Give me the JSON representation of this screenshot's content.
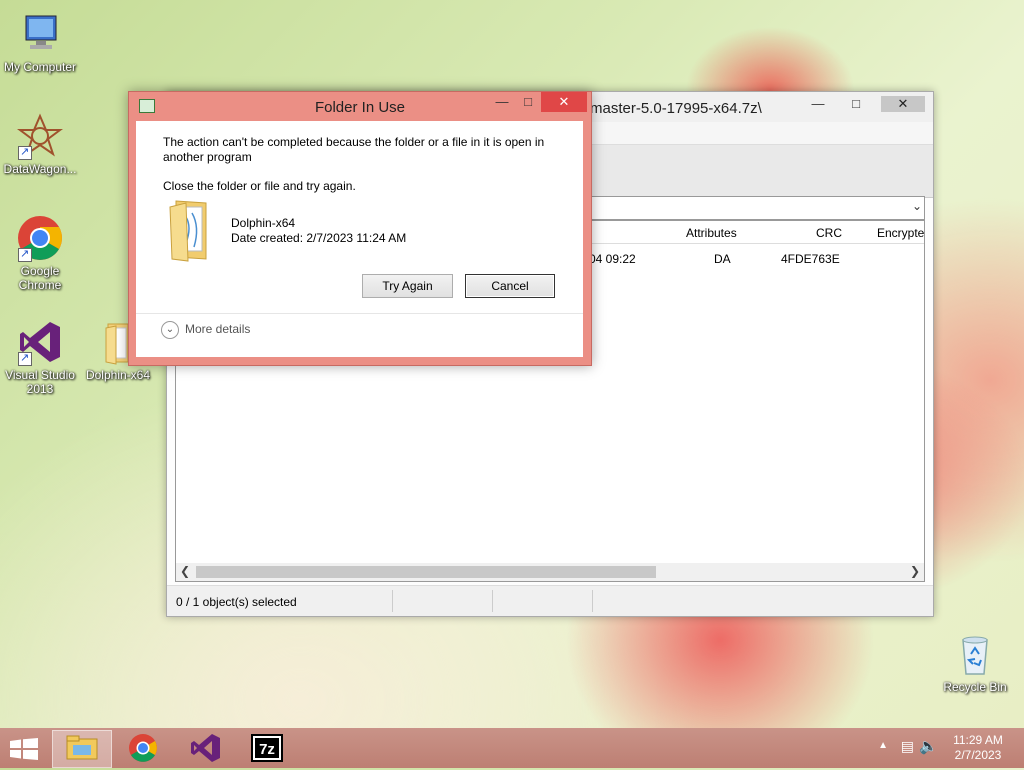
{
  "desktop": {
    "icons": [
      {
        "label": "My Computer"
      },
      {
        "label": "DataWagon..."
      },
      {
        "label": "Google Chrome"
      },
      {
        "label": "Visual Studio 2013"
      },
      {
        "label": "Dolphin-x64"
      },
      {
        "label": "Recycle Bin"
      }
    ]
  },
  "zip_window": {
    "title_path": "master-5.0-17995-x64.7z\\",
    "columns": [
      "Attributes",
      "CRC",
      "Encrypte"
    ],
    "row": {
      "modified": "04 09:22",
      "attributes": "DA",
      "crc": "4FDE763E"
    },
    "status": "0 / 1 object(s) selected"
  },
  "dialog": {
    "title": "Folder In Use",
    "message": "The action can't be completed because the folder or a file in it is open in another program",
    "instruction": "Close the folder or file and try again.",
    "file_name": "Dolphin-x64",
    "date_created": "Date created: 2/7/2023 11:24 AM",
    "try_again": "Try Again",
    "cancel": "Cancel",
    "more_details": "More details"
  },
  "taskbar": {
    "time": "11:29 AM",
    "date": "2/7/2023"
  },
  "colors": {
    "dialog_frame": "#eb8f85",
    "close_button": "#e04747",
    "taskbar": "#bd7f73"
  }
}
